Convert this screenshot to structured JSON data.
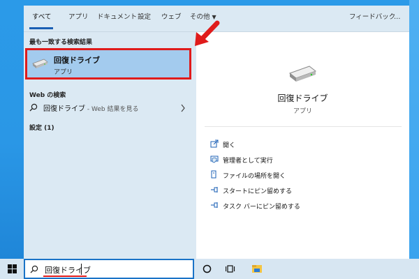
{
  "tabs": [
    {
      "label": "すべて"
    },
    {
      "label": "アプリ"
    },
    {
      "label": "ドキュメント"
    },
    {
      "label": "設定"
    },
    {
      "label": "ウェブ"
    },
    {
      "label": "その他"
    }
  ],
  "feedback_label": "フィードバック",
  "more_label": "…",
  "left": {
    "best_match_header": "最も一致する検索結果",
    "best_match": {
      "title": "回復ドライブ",
      "subtitle": "アプリ"
    },
    "web_header": "Web の検索",
    "web_item": {
      "query": "回復ドライブ",
      "suffix": " - Web 結果を見る"
    },
    "settings_header": "設定 (1)"
  },
  "right": {
    "app_title": "回復ドライブ",
    "app_subtitle": "アプリ",
    "actions": [
      {
        "label": "開く",
        "icon": "open-icon"
      },
      {
        "label": "管理者として実行",
        "icon": "admin-icon"
      },
      {
        "label": "ファイルの場所を開く",
        "icon": "file-location-icon"
      },
      {
        "label": "スタートにピン留めする",
        "icon": "pin-icon"
      },
      {
        "label": "タスク バーにピン留めする",
        "icon": "pin-icon"
      }
    ]
  },
  "taskbar": {
    "search_value": "回復ドライブ"
  },
  "colors": {
    "accent": "#1a5fb4",
    "highlight_border": "#e01b1b",
    "selected_bg": "#a3cbee"
  }
}
